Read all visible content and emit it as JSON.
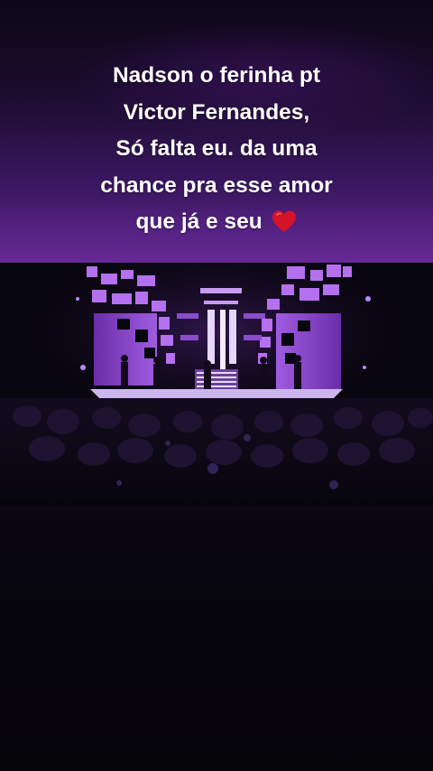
{
  "caption": {
    "lines": [
      "Nadson o ferinha pt",
      "Victor Fernandes,",
      "Só falta eu. da uma",
      "chance pra esse amor",
      "que já e seu"
    ],
    "emoji": "heart-emoji"
  },
  "colors": {
    "accent_purple": "#8a3dd0",
    "heart_red": "#d3132a",
    "background": "#07050d"
  },
  "video": {
    "scene": "concert stage with purple LED screens, band and audience silhouettes"
  }
}
